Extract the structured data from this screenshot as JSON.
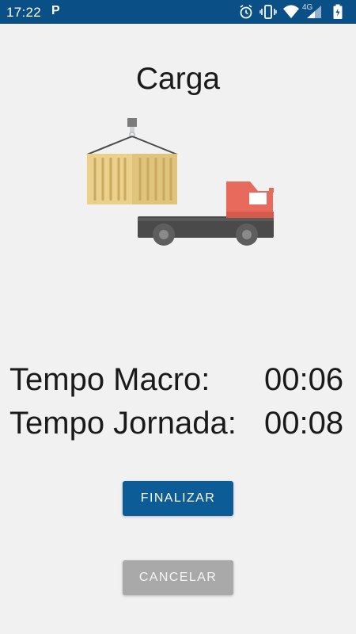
{
  "status_bar": {
    "time": "17:22",
    "app_badge": "P",
    "network_label": "4G",
    "icons": [
      "p-notification-icon",
      "alarm-icon",
      "vibrate-icon",
      "wifi-icon",
      "cell-signal-icon",
      "battery-icon"
    ]
  },
  "screen": {
    "title": "Carga",
    "illustration": "truck-container-crane-illustration",
    "rows": [
      {
        "label": "Tempo Macro:",
        "value": "00:06"
      },
      {
        "label": "Tempo Jornada:",
        "value": "00:08"
      }
    ],
    "buttons": {
      "finalizar": "FINALIZAR",
      "cancelar": "CANCELAR"
    }
  },
  "colors": {
    "status_bar": "#0b4f87",
    "primary_button": "#0b5c97",
    "secondary_button": "#a9a9a9",
    "background": "#f1f1f1",
    "truck_cab": "#e86a5c",
    "container": "#dfc27a"
  }
}
